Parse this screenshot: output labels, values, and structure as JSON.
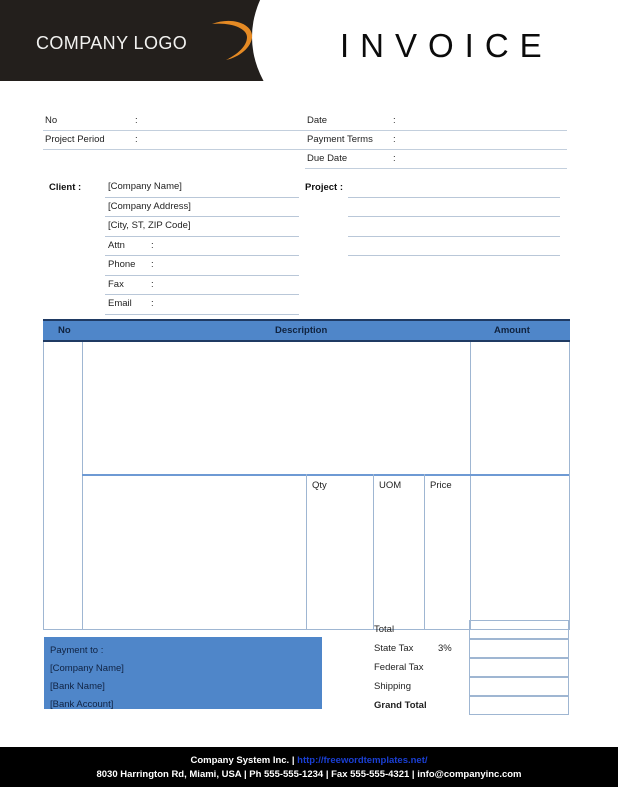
{
  "header": {
    "logo_text": "COMPANY LOGO",
    "logo_swoosh_icon": "swoosh-arc-icon",
    "logo_swoosh_color": "#E58A24",
    "title": "INVOICE",
    "band_color": "#231F1C"
  },
  "meta": {
    "left": [
      {
        "label": "No",
        "colon": ":",
        "value": ""
      },
      {
        "label": "Project Period",
        "colon": ":",
        "value": ""
      }
    ],
    "right": [
      {
        "label": "Date",
        "colon": ":",
        "value": ""
      },
      {
        "label": "Payment  Terms",
        "colon": ":",
        "value": ""
      },
      {
        "label": "Due Date",
        "colon": ":",
        "value": ""
      }
    ]
  },
  "client": {
    "label": "Client :",
    "rows": [
      {
        "label": "[Company Name]",
        "colon": "",
        "value": ""
      },
      {
        "label": "[Company Address]",
        "colon": "",
        "value": ""
      },
      {
        "label": "[City, ST, ZIP Code]",
        "colon": "",
        "value": ""
      },
      {
        "label": "Attn",
        "colon": ":",
        "value": ""
      },
      {
        "label": "Phone",
        "colon": ":",
        "value": ""
      },
      {
        "label": "Fax",
        "colon": ":",
        "value": ""
      },
      {
        "label": "Email",
        "colon": ":",
        "value": ""
      }
    ]
  },
  "project": {
    "label": "Project :",
    "rows": [
      {
        "value": ""
      },
      {
        "value": ""
      },
      {
        "value": ""
      },
      {
        "value": ""
      }
    ]
  },
  "items_table": {
    "header_bg": "#4F86C9",
    "header_border": "#1F3A63",
    "columns": {
      "no": "No",
      "description": "Description",
      "amount": "Amount"
    },
    "subcolumns": {
      "qty": "Qty",
      "uom": "UOM",
      "price": "Price"
    },
    "rows": []
  },
  "payment": {
    "box_color": "#4F86C9",
    "lines": [
      "Payment to :",
      "[Company Name]",
      "[Bank Name]",
      "[Bank Account]"
    ]
  },
  "totals": {
    "rows": [
      {
        "label": "Total",
        "pct": "",
        "value": "",
        "bold": false
      },
      {
        "label": "State Tax",
        "pct": "3%",
        "value": "",
        "bold": false
      },
      {
        "label": "Federal Tax",
        "pct": "",
        "value": "",
        "bold": false
      },
      {
        "label": "Shipping",
        "pct": "",
        "value": "",
        "bold": false
      },
      {
        "label": "Grand Total",
        "pct": "",
        "value": "",
        "bold": true
      }
    ]
  },
  "footer": {
    "line1_prefix": "Company System Inc. | ",
    "line1_link": "http://freewordtemplates.net/",
    "line2": "8030 Harrington Rd, Miami, USA | Ph 555-555-1234 | Fax 555-555-4321 | info@companyinc.com",
    "bg": "#000000",
    "link_color": "#1A3FD4"
  }
}
